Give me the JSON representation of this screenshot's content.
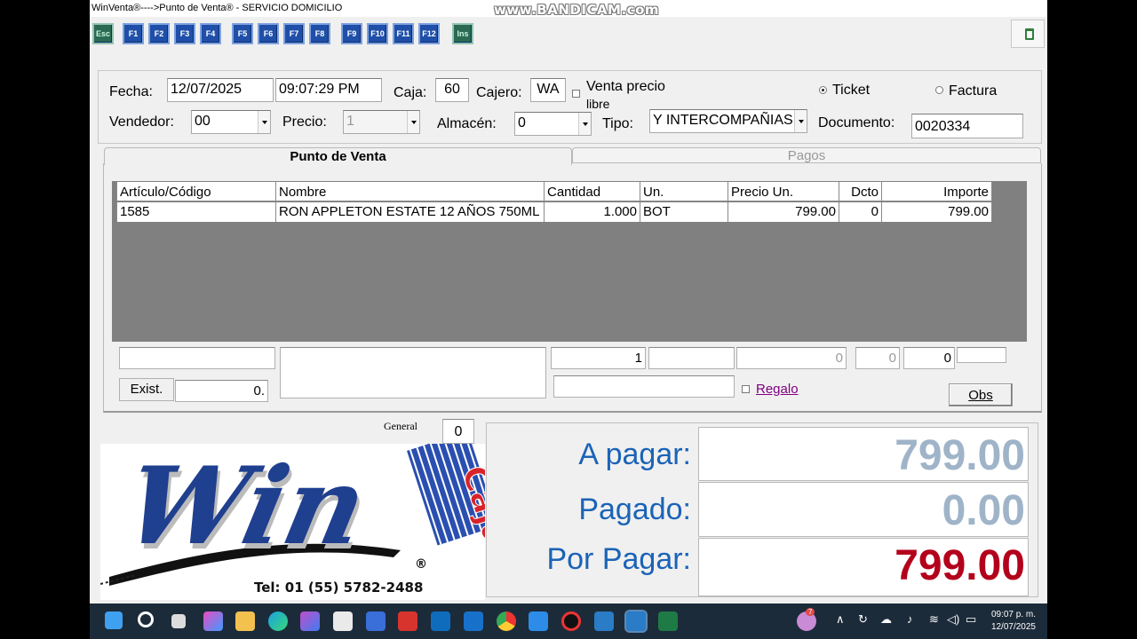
{
  "window": {
    "title": "WinVenta®---->Punto de Venta® - SERVICIO DOMICILIO",
    "watermark": "www.BANDICAM.com"
  },
  "toolbar": {
    "keys": [
      "Esc",
      "F1",
      "F2",
      "F3",
      "F4",
      "F5",
      "F6",
      "F7",
      "F8",
      "F9",
      "F10",
      "F11",
      "F12",
      "Ins"
    ]
  },
  "header": {
    "fecha_label": "Fecha:",
    "fecha": "12/07/2025",
    "hora": "09:07:29 PM",
    "caja_label": "Caja:",
    "caja": "60",
    "cajero_label": "Cajero:",
    "cajero": "WA",
    "venta_precio_libre_label_1": "Venta  precio",
    "venta_precio_libre_label_2": "libre",
    "ticket_label": "Ticket",
    "factura_label": "Factura",
    "vendedor_label": "Vendedor:",
    "vendedor": "00",
    "precio_label": "Precio:",
    "precio": "1",
    "almacen_label": "Almacén:",
    "almacen": "0",
    "tipo_label": "Tipo:",
    "tipo": "Y INTERCOMPAÑIAS",
    "documento_label": "Documento:",
    "documento": "0020334"
  },
  "tabs": {
    "main": "Punto de Venta",
    "pagos": "Pagos"
  },
  "grid": {
    "columns": [
      "Artículo/Código",
      "Nombre",
      "Cantidad",
      "Un.",
      "Precio Un.",
      "Dcto",
      "Importe"
    ],
    "rows": [
      {
        "articulo": "1585",
        "nombre": "RON APPLETON ESTATE 12 AÑOS 750ML",
        "cantidad": "1.000",
        "un": "BOT",
        "precio": "799.00",
        "dcto": "0",
        "importe": "799.00"
      }
    ]
  },
  "entry": {
    "cantidad": "1",
    "precio": "0",
    "dcto": "0",
    "importe": "0",
    "exist_label": "Exist.",
    "exist_value": "0.",
    "regalo_label": "Regalo",
    "obs_label": "Obs"
  },
  "general": {
    "label": "General",
    "value": "0"
  },
  "totals": {
    "a_pagar_label": "A pagar:",
    "a_pagar": "799.00",
    "pagado_label": "Pagado:",
    "pagado": "0.00",
    "por_pagar_label": "Por Pagar:",
    "por_pagar": "799.00"
  },
  "logo": {
    "brand": "Win",
    "sub": "Caja",
    "registered": "®",
    "phone": "Tel: 01 (55) 5782-2488"
  },
  "taskbar": {
    "notification_count": "7",
    "time": "09:07 p. m.",
    "date": "12/07/2025"
  },
  "colors": {
    "label_blue": "#1b63b7",
    "paid_gray": "#9fb4c8",
    "due_red": "#b3001b",
    "regalo": "#800080"
  }
}
